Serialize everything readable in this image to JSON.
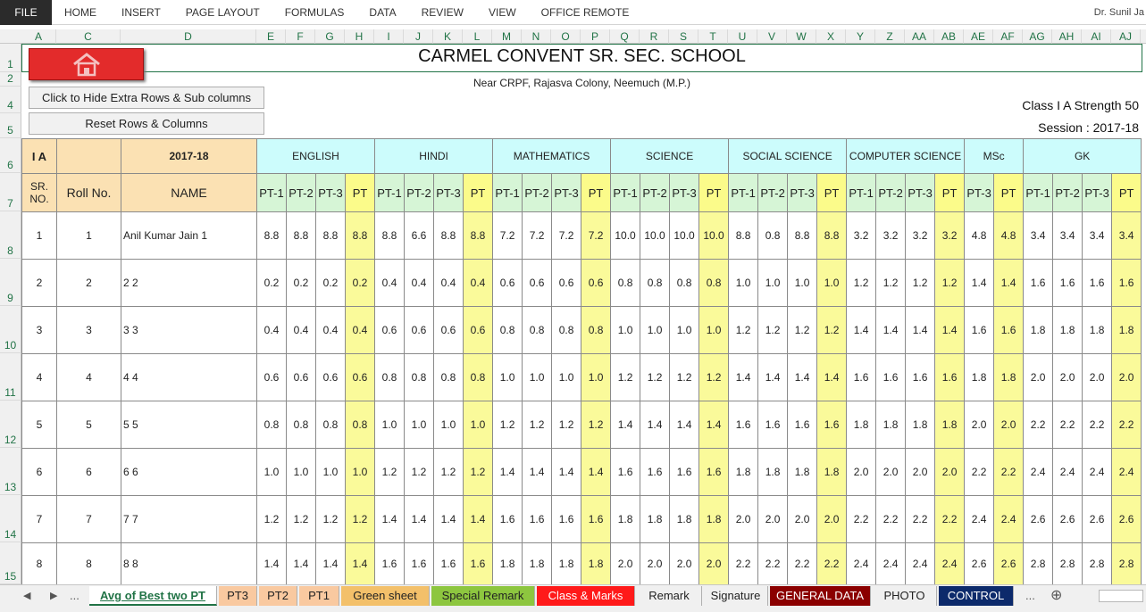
{
  "ribbon": {
    "file": "FILE",
    "tabs": [
      "HOME",
      "INSERT",
      "PAGE LAYOUT",
      "FORMULAS",
      "DATA",
      "REVIEW",
      "VIEW",
      "OFFICE REMOTE"
    ],
    "user": "Dr. Sunil Ja"
  },
  "columns": [
    "A",
    "C",
    "D",
    "E",
    "F",
    "G",
    "H",
    "I",
    "J",
    "K",
    "L",
    "M",
    "N",
    "O",
    "P",
    "Q",
    "R",
    "S",
    "T",
    "U",
    "V",
    "W",
    "X",
    "Y",
    "Z",
    "AA",
    "AB",
    "AE",
    "AF",
    "AG",
    "AH",
    "AI",
    "AJ"
  ],
  "rows": [
    "1",
    "2",
    "4",
    "5",
    "6",
    "7",
    "8",
    "9",
    "10",
    "11",
    "12",
    "13",
    "14",
    "15"
  ],
  "school": {
    "title": "CARMEL CONVENT SR. SEC. SCHOOL",
    "address": "Near CRPF, Rajasva Colony, Neemuch (M.P.)",
    "class_strength": "Class I A Strength 50",
    "session": "Session : 2017-18"
  },
  "buttons": {
    "hide": "Click to Hide Extra Rows & Sub columns",
    "reset": "Reset Rows & Columns",
    "home_icon": "home-icon"
  },
  "header": {
    "class": "I A",
    "year": "2017-18",
    "sr": "SR. NO.",
    "roll": "Roll No.",
    "name": "NAME",
    "subjects": [
      "ENGLISH",
      "HINDI",
      "MATHEMATICS",
      "SCIENCE",
      "SOCIAL SCIENCE",
      "COMPUTER SCIENCE",
      "MSc",
      "GK"
    ],
    "sub_labels": [
      "PT-1",
      "PT-2",
      "PT-3",
      "PT",
      "PT-1",
      "PT-2",
      "PT-3",
      "PT",
      "PT-1",
      "PT-2",
      "PT-3",
      "PT",
      "PT-1",
      "PT-2",
      "PT-3",
      "PT",
      "PT-1",
      "PT-2",
      "PT-3",
      "PT",
      "PT-1",
      "PT-2",
      "PT-3",
      "PT",
      "PT-3",
      "PT",
      "PT-1",
      "PT-2",
      "PT-3",
      "PT"
    ]
  },
  "students": [
    {
      "sr": "1",
      "roll": "1",
      "name": "Anil Kumar Jain 1",
      "marks": [
        "8.8",
        "8.8",
        "8.8",
        "8.8",
        "8.8",
        "6.6",
        "8.8",
        "8.8",
        "7.2",
        "7.2",
        "7.2",
        "7.2",
        "10.0",
        "10.0",
        "10.0",
        "10.0",
        "8.8",
        "0.8",
        "8.8",
        "8.8",
        "3.2",
        "3.2",
        "3.2",
        "3.2",
        "4.8",
        "4.8",
        "3.4",
        "3.4",
        "3.4",
        "3.4"
      ]
    },
    {
      "sr": "2",
      "roll": "2",
      "name": "2 2",
      "marks": [
        "0.2",
        "0.2",
        "0.2",
        "0.2",
        "0.4",
        "0.4",
        "0.4",
        "0.4",
        "0.6",
        "0.6",
        "0.6",
        "0.6",
        "0.8",
        "0.8",
        "0.8",
        "0.8",
        "1.0",
        "1.0",
        "1.0",
        "1.0",
        "1.2",
        "1.2",
        "1.2",
        "1.2",
        "1.4",
        "1.4",
        "1.6",
        "1.6",
        "1.6",
        "1.6"
      ]
    },
    {
      "sr": "3",
      "roll": "3",
      "name": "3 3",
      "marks": [
        "0.4",
        "0.4",
        "0.4",
        "0.4",
        "0.6",
        "0.6",
        "0.6",
        "0.6",
        "0.8",
        "0.8",
        "0.8",
        "0.8",
        "1.0",
        "1.0",
        "1.0",
        "1.0",
        "1.2",
        "1.2",
        "1.2",
        "1.2",
        "1.4",
        "1.4",
        "1.4",
        "1.4",
        "1.6",
        "1.6",
        "1.8",
        "1.8",
        "1.8",
        "1.8"
      ]
    },
    {
      "sr": "4",
      "roll": "4",
      "name": "4 4",
      "marks": [
        "0.6",
        "0.6",
        "0.6",
        "0.6",
        "0.8",
        "0.8",
        "0.8",
        "0.8",
        "1.0",
        "1.0",
        "1.0",
        "1.0",
        "1.2",
        "1.2",
        "1.2",
        "1.2",
        "1.4",
        "1.4",
        "1.4",
        "1.4",
        "1.6",
        "1.6",
        "1.6",
        "1.6",
        "1.8",
        "1.8",
        "2.0",
        "2.0",
        "2.0",
        "2.0"
      ]
    },
    {
      "sr": "5",
      "roll": "5",
      "name": "5 5",
      "marks": [
        "0.8",
        "0.8",
        "0.8",
        "0.8",
        "1.0",
        "1.0",
        "1.0",
        "1.0",
        "1.2",
        "1.2",
        "1.2",
        "1.2",
        "1.4",
        "1.4",
        "1.4",
        "1.4",
        "1.6",
        "1.6",
        "1.6",
        "1.6",
        "1.8",
        "1.8",
        "1.8",
        "1.8",
        "2.0",
        "2.0",
        "2.2",
        "2.2",
        "2.2",
        "2.2"
      ]
    },
    {
      "sr": "6",
      "roll": "6",
      "name": "6 6",
      "marks": [
        "1.0",
        "1.0",
        "1.0",
        "1.0",
        "1.2",
        "1.2",
        "1.2",
        "1.2",
        "1.4",
        "1.4",
        "1.4",
        "1.4",
        "1.6",
        "1.6",
        "1.6",
        "1.6",
        "1.8",
        "1.8",
        "1.8",
        "1.8",
        "2.0",
        "2.0",
        "2.0",
        "2.0",
        "2.2",
        "2.2",
        "2.4",
        "2.4",
        "2.4",
        "2.4"
      ]
    },
    {
      "sr": "7",
      "roll": "7",
      "name": "7 7",
      "marks": [
        "1.2",
        "1.2",
        "1.2",
        "1.2",
        "1.4",
        "1.4",
        "1.4",
        "1.4",
        "1.6",
        "1.6",
        "1.6",
        "1.6",
        "1.8",
        "1.8",
        "1.8",
        "1.8",
        "2.0",
        "2.0",
        "2.0",
        "2.0",
        "2.2",
        "2.2",
        "2.2",
        "2.2",
        "2.4",
        "2.4",
        "2.6",
        "2.6",
        "2.6",
        "2.6"
      ]
    },
    {
      "sr": "8",
      "roll": "8",
      "name": "8 8",
      "marks": [
        "1.4",
        "1.4",
        "1.4",
        "1.4",
        "1.6",
        "1.6",
        "1.6",
        "1.6",
        "1.8",
        "1.8",
        "1.8",
        "1.8",
        "2.0",
        "2.0",
        "2.0",
        "2.0",
        "2.2",
        "2.2",
        "2.2",
        "2.2",
        "2.4",
        "2.4",
        "2.4",
        "2.4",
        "2.6",
        "2.6",
        "2.8",
        "2.8",
        "2.8",
        "2.8"
      ]
    }
  ],
  "sheet_tabs": [
    {
      "label": "Avg of Best two PT",
      "bg": "#ffffff",
      "fg": "#217346",
      "active": true
    },
    {
      "label": "PT3",
      "bg": "#f9c9a0",
      "fg": "#222222"
    },
    {
      "label": "PT2",
      "bg": "#f9c9a0",
      "fg": "#222222"
    },
    {
      "label": "PT1",
      "bg": "#f9c9a0",
      "fg": "#222222"
    },
    {
      "label": "Green sheet",
      "bg": "#f3c06a",
      "fg": "#222222"
    },
    {
      "label": "Special Remark",
      "bg": "#8dc63f",
      "fg": "#222222"
    },
    {
      "label": "Class & Marks",
      "bg": "#ff1a1a",
      "fg": "#ffffff"
    },
    {
      "label": "Remark",
      "bg": "#f0f0f0",
      "fg": "#222222"
    },
    {
      "label": "Signature",
      "bg": "#f0f0f0",
      "fg": "#222222"
    },
    {
      "label": "GENERAL DATA",
      "bg": "#8b0000",
      "fg": "#ffffff"
    },
    {
      "label": "PHOTO",
      "bg": "#f0f0f0",
      "fg": "#222222"
    },
    {
      "label": "CONTROL",
      "bg": "#0c2a6b",
      "fg": "#ffffff"
    }
  ],
  "sheet_nav": {
    "prev": "◀",
    "next": "▶",
    "more_left": "...",
    "more_right": "...",
    "add": "⊕"
  }
}
